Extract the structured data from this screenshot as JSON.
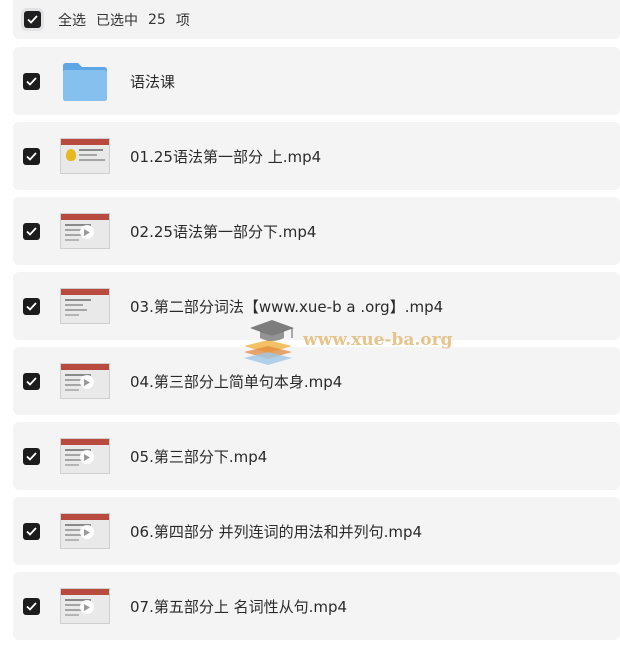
{
  "header": {
    "select_all": "全选",
    "selected_prefix": "已选中",
    "selected_count": "25",
    "selected_unit": "项"
  },
  "items": [
    {
      "label": "语法课",
      "type": "folder",
      "checked": true
    },
    {
      "label": "01.25语法第一部分 上.mp4",
      "type": "video",
      "checked": true
    },
    {
      "label": "02.25语法第一部分下.mp4",
      "type": "video",
      "checked": true
    },
    {
      "label": "03.第二部分词法【www.xue-b a .org】.mp4",
      "type": "video",
      "checked": true
    },
    {
      "label": "04.第三部分上简单句本身.mp4",
      "type": "video",
      "checked": true
    },
    {
      "label": "05.第三部分下.mp4",
      "type": "video",
      "checked": true
    },
    {
      "label": "06.第四部分 并列连词的用法和并列句.mp4",
      "type": "video",
      "checked": true
    },
    {
      "label": "07.第五部分上 名词性从句.mp4",
      "type": "video",
      "checked": true
    }
  ],
  "watermark": {
    "text": "www.xue-ba.org",
    "icon": "graduation-cap-books-icon"
  },
  "colors": {
    "row_bg": "#f4f4f5",
    "checkbox": "#1c1c1c",
    "folder": "#7ab8ea",
    "text": "#2a2a2a"
  }
}
